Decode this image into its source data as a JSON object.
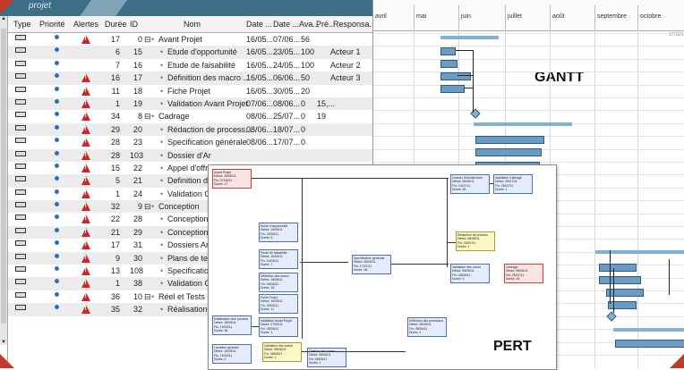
{
  "app": {
    "brand": "projet"
  },
  "columns": [
    "Type",
    "Priorité",
    "Alertes",
    "Durée",
    "ID",
    "Nom",
    "Date ...",
    "Date ...",
    "Ava...",
    "Pré...",
    "Responsa..."
  ],
  "rows": [
    {
      "alert": true,
      "duration": "17",
      "id": "0",
      "expand": "⊟",
      "name": "Avant Projet",
      "start": "16/05...",
      "end": "07/06...",
      "progress": "56",
      "pred": "",
      "resp": "",
      "indent": 0
    },
    {
      "alert": false,
      "duration": "6",
      "id": "15",
      "expand": "",
      "name": "Etude d'opportunité",
      "start": "16/05...",
      "end": "23/05...",
      "progress": "100",
      "pred": "",
      "resp": "Acteur 1",
      "indent": 1
    },
    {
      "alert": false,
      "duration": "7",
      "id": "16",
      "expand": "",
      "name": "Etude de faisabilité",
      "start": "16/05...",
      "end": "24/05...",
      "progress": "100",
      "pred": "",
      "resp": "Acteur 2",
      "indent": 1
    },
    {
      "alert": true,
      "duration": "16",
      "id": "17",
      "expand": "",
      "name": "Définition des macro ...",
      "start": "16/05...",
      "end": "06/06...",
      "progress": "50",
      "pred": "",
      "resp": "Acteur 3",
      "indent": 1
    },
    {
      "alert": true,
      "duration": "11",
      "id": "18",
      "expand": "",
      "name": "Fiche Projet",
      "start": "16/05...",
      "end": "30/05...",
      "progress": "20",
      "pred": "",
      "resp": "",
      "indent": 1
    },
    {
      "alert": true,
      "duration": "1",
      "id": "19",
      "expand": "",
      "name": "Validation Avant Projet",
      "start": "07/06...",
      "end": "08/06...",
      "progress": "0",
      "pred": "15,...",
      "resp": "",
      "indent": 1
    },
    {
      "alert": true,
      "duration": "34",
      "id": "8",
      "expand": "⊟",
      "name": "Cadrage",
      "start": "08/06...",
      "end": "25/07...",
      "progress": "0",
      "pred": "19",
      "resp": "",
      "indent": 0
    },
    {
      "alert": true,
      "duration": "29",
      "id": "20",
      "expand": "",
      "name": "Rédaction de process...",
      "start": "08/06...",
      "end": "18/07...",
      "progress": "0",
      "pred": "",
      "resp": "",
      "indent": 1
    },
    {
      "alert": true,
      "duration": "28",
      "id": "23",
      "expand": "",
      "name": "Specification générale",
      "start": "08/06...",
      "end": "17/07...",
      "progress": "0",
      "pred": "",
      "resp": "",
      "indent": 1
    },
    {
      "alert": true,
      "duration": "28",
      "id": "103",
      "expand": "",
      "name": "Dossier d'Ar",
      "start": "",
      "end": "",
      "progress": "",
      "pred": "",
      "resp": "",
      "indent": 1
    },
    {
      "alert": true,
      "duration": "15",
      "id": "22",
      "expand": "",
      "name": "Appel d'offr",
      "start": "",
      "end": "",
      "progress": "",
      "pred": "",
      "resp": "",
      "indent": 1
    },
    {
      "alert": true,
      "duration": "5",
      "id": "21",
      "expand": "",
      "name": "Definition d",
      "start": "",
      "end": "",
      "progress": "",
      "pred": "",
      "resp": "",
      "indent": 1
    },
    {
      "alert": true,
      "duration": "1",
      "id": "24",
      "expand": "",
      "name": "Validation C",
      "start": "",
      "end": "",
      "progress": "",
      "pred": "",
      "resp": "",
      "indent": 1
    },
    {
      "alert": true,
      "duration": "32",
      "id": "9",
      "expand": "⊟",
      "name": "Conception",
      "start": "",
      "end": "",
      "progress": "",
      "pred": "",
      "resp": "",
      "indent": 0
    },
    {
      "alert": true,
      "duration": "22",
      "id": "28",
      "expand": "",
      "name": "Conception",
      "start": "",
      "end": "",
      "progress": "",
      "pred": "",
      "resp": "",
      "indent": 1
    },
    {
      "alert": true,
      "duration": "21",
      "id": "29",
      "expand": "",
      "name": "Conception",
      "start": "",
      "end": "",
      "progress": "",
      "pred": "",
      "resp": "",
      "indent": 1
    },
    {
      "alert": true,
      "duration": "17",
      "id": "31",
      "expand": "",
      "name": "Dossiers Arc",
      "start": "",
      "end": "",
      "progress": "",
      "pred": "",
      "resp": "",
      "indent": 1
    },
    {
      "alert": true,
      "duration": "9",
      "id": "30",
      "expand": "",
      "name": "Plans de tes",
      "start": "",
      "end": "",
      "progress": "",
      "pred": "",
      "resp": "",
      "indent": 1
    },
    {
      "alert": true,
      "duration": "13",
      "id": "108",
      "expand": "",
      "name": "Specification",
      "start": "",
      "end": "",
      "progress": "",
      "pred": "",
      "resp": "",
      "indent": 1
    },
    {
      "alert": true,
      "duration": "1",
      "id": "38",
      "expand": "",
      "name": "Validation C",
      "start": "",
      "end": "",
      "progress": "",
      "pred": "",
      "resp": "",
      "indent": 1
    },
    {
      "alert": true,
      "duration": "36",
      "id": "10",
      "expand": "⊟",
      "name": "Réel et Tests u",
      "start": "",
      "end": "",
      "progress": "",
      "pred": "",
      "resp": "",
      "indent": 0
    },
    {
      "alert": true,
      "duration": "35",
      "id": "32",
      "expand": "",
      "name": "Réalisation",
      "start": "",
      "end": "",
      "progress": "",
      "pred": "",
      "resp": "",
      "indent": 1
    }
  ],
  "gantt": {
    "months": [
      "avril",
      "mai",
      "juin",
      "juillet",
      "août",
      "septembre",
      "octobre"
    ],
    "label": "GANTT",
    "stamp": "17/10/1"
  },
  "pert": {
    "label": "PERT",
    "nodes": [
      {
        "title": "Avant Projet",
        "lines": [
          "Début: 16/05/11",
          "Fin: 07/06/11",
          "Durée: 17"
        ],
        "style": "red"
      },
      {
        "title": "Etude d'opportunité",
        "lines": [
          "Début: 16/05/11",
          "Fin: 23/05/11",
          "Durée: 6"
        ],
        "style": ""
      },
      {
        "title": "Etude de faisabilité",
        "lines": [
          "Début: 16/05/11",
          "Fin: 24/05/11",
          "Durée: 7"
        ],
        "style": ""
      },
      {
        "title": "Définition des macro",
        "lines": [
          "Début: 16/05/11",
          "Fin: 06/06/11",
          "Durée: 16"
        ],
        "style": ""
      },
      {
        "title": "Fiche Projet",
        "lines": [
          "Début: 16/05/11",
          "Fin: 30/05/11",
          "Durée: 11"
        ],
        "style": ""
      },
      {
        "title": "Validation Avant Projet",
        "lines": [
          "Début: 07/06/11",
          "Fin: 08/06/11",
          "Durée: 1"
        ],
        "style": ""
      },
      {
        "title": "Initialisation des process",
        "lines": [
          "Début: 16/05/11",
          "Fin: 16/05/11",
          "Durée: 35"
        ],
        "style": ""
      },
      {
        "title": "Validation des comm",
        "lines": [
          "Début: 08/06/11",
          "Fin: 08/06/11",
          "Durée: 1"
        ],
        "style": "yellow"
      },
      {
        "title": "Dossier d'Architecture",
        "lines": [
          "Début: 08/06/11",
          "Fin: 14/07/11",
          "Durée: 28"
        ],
        "style": ""
      },
      {
        "title": "Validation Cadrage",
        "lines": [
          "Début: 25/07/11",
          "Fin: 26/07/11",
          "Durée: 1"
        ],
        "style": ""
      },
      {
        "title": "Cadrage",
        "lines": [
          "Début: 08/06/11",
          "Fin: 25/07/11",
          "Durée: 34"
        ],
        "style": "red"
      },
      {
        "title": "Rédaction de process",
        "lines": [
          "Début: 08/06/11",
          "Fin: 18/07/11",
          "Durée: 1"
        ],
        "style": "yellow"
      },
      {
        "title": "Specification générale",
        "lines": [
          "Début: 08/06/11",
          "Fin: 17/07/11",
          "Durée: 28"
        ],
        "style": ""
      },
      {
        "title": "Validation des comm",
        "lines": [
          "Début: 08/06/11",
          "Fin: 08/06/11",
          "Durée: 0"
        ],
        "style": ""
      },
      {
        "title": "Livrables générés",
        "lines": [
          "Début: 16/05/11",
          "Fin: 16/05/11",
          "Durée: 0"
        ],
        "style": ""
      },
      {
        "title": "Définition des processus",
        "lines": [
          "Début: 08/06/11",
          "Fin: 08/06/11",
          "Durée: 1"
        ],
        "style": ""
      },
      {
        "title": "Gestion des comm",
        "lines": [
          "Début: 08/06/11",
          "Fin: 08/06/11",
          "Durée: 1"
        ],
        "style": ""
      }
    ]
  }
}
